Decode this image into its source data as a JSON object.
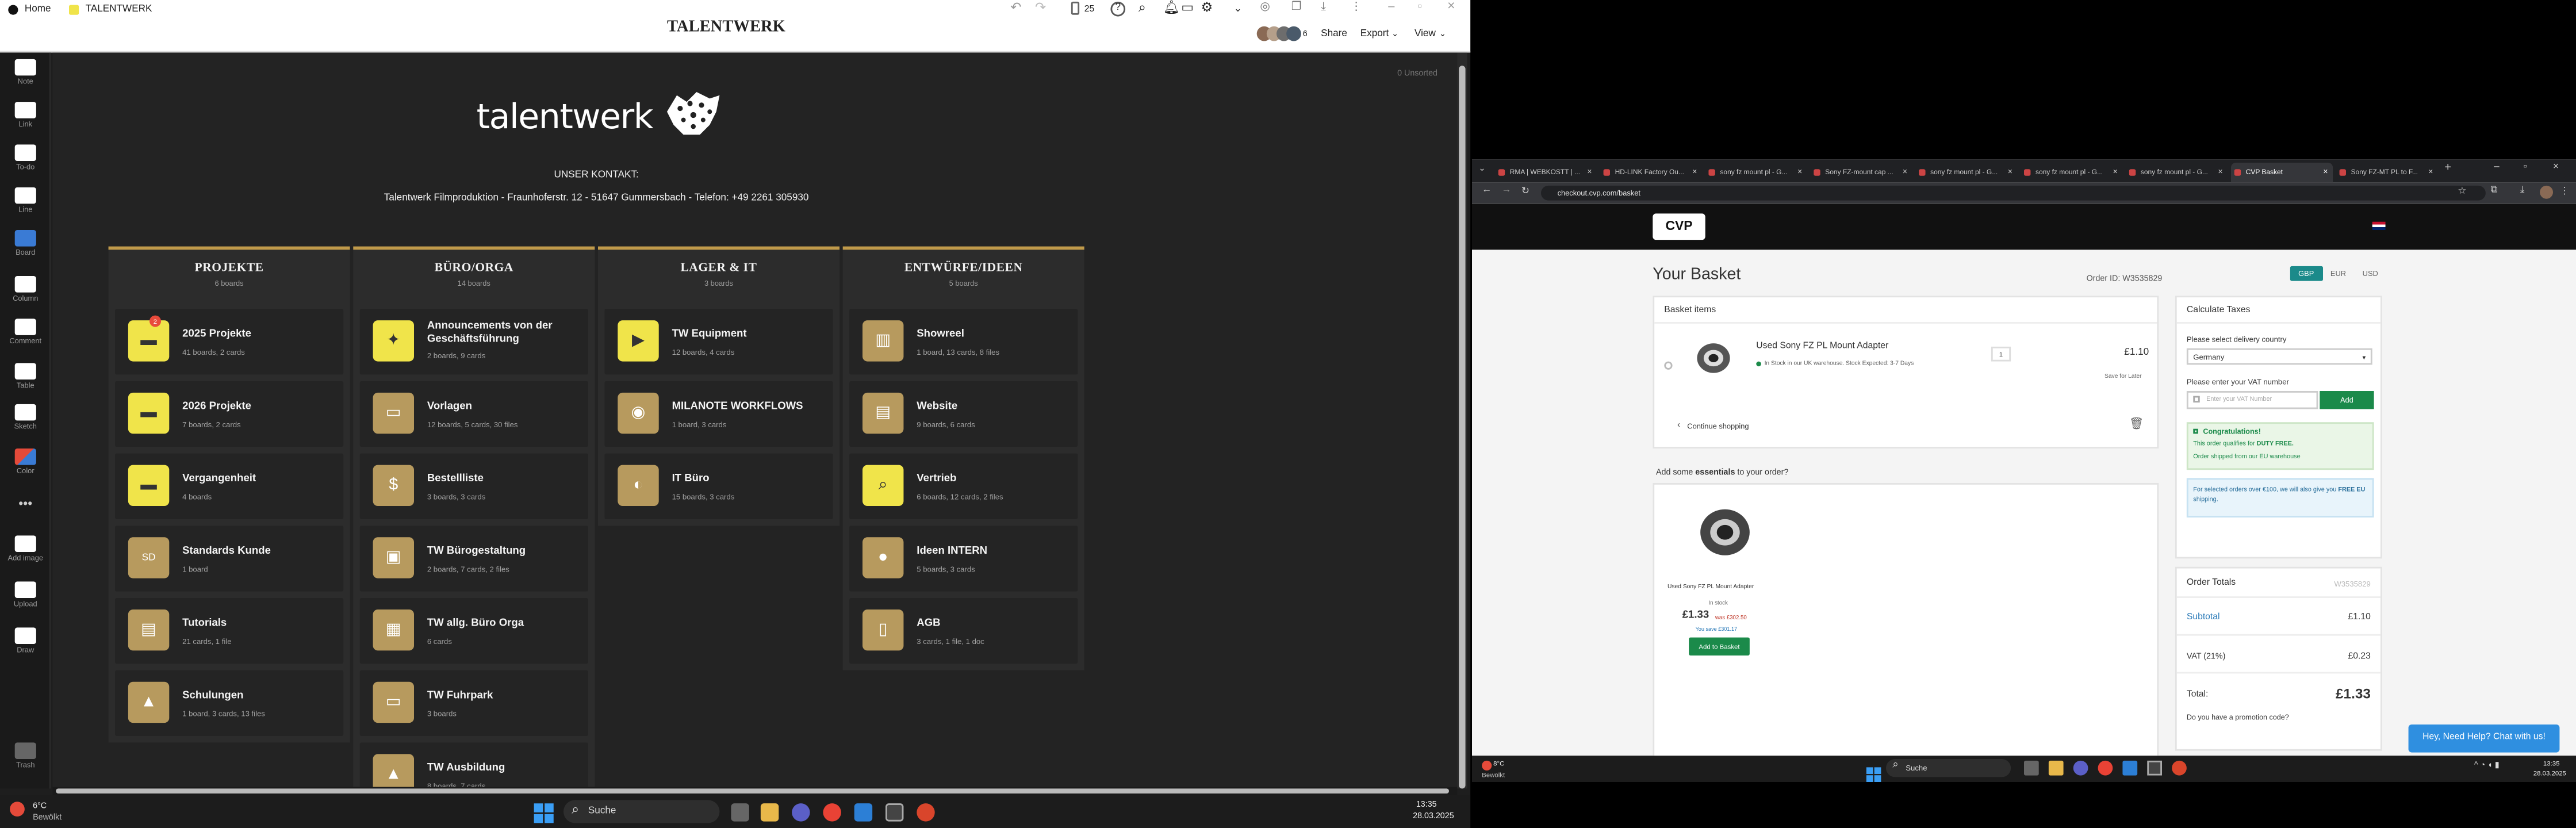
{
  "milanote": {
    "topbar": {
      "home": "Home",
      "breadcrumb": "TALENTWERK",
      "title": "TALENTWERK",
      "count": "25",
      "share": "Share",
      "export": "Export",
      "view": "View"
    },
    "sidebar": [
      {
        "label": "Note",
        "icon": "note-icon"
      },
      {
        "label": "Link",
        "icon": "link-icon"
      },
      {
        "label": "To-do",
        "icon": "todo-icon"
      },
      {
        "label": "Line",
        "icon": "line-icon"
      },
      {
        "label": "Board",
        "icon": "board-icon"
      },
      {
        "label": "Column",
        "icon": "column-icon"
      },
      {
        "label": "Comment",
        "icon": "comment-icon"
      },
      {
        "label": "Table",
        "icon": "table-icon"
      },
      {
        "label": "Sketch",
        "icon": "sketch-icon"
      },
      {
        "label": "Color",
        "icon": "color-icon"
      },
      {
        "label": "Add image",
        "icon": "image-icon"
      },
      {
        "label": "Upload",
        "icon": "upload-icon"
      },
      {
        "label": "Draw",
        "icon": "draw-icon"
      },
      {
        "label": "Trash",
        "icon": "trash-icon"
      }
    ],
    "unsorted": "0 Unsorted",
    "logo_text": "talentwerk",
    "contact_heading": "UNSER KONTAKT:",
    "contact_line": "Talentwerk Filmproduktion - Fraunhoferstr. 12 - 51647 Gummersbach - Telefon: +49 2261 305930",
    "columns": [
      {
        "title": "PROJEKTE",
        "subtitle": "6 boards",
        "cards": [
          {
            "name": "2025 Projekte",
            "sub": "41 boards, 2 cards",
            "style": "y",
            "icon": "folder-icon",
            "badge": "2"
          },
          {
            "name": "2026 Projekte",
            "sub": "7 boards, 2 cards",
            "style": "y",
            "icon": "folder-icon"
          },
          {
            "name": "Vergangenheit",
            "sub": "4 boards",
            "style": "y",
            "icon": "folder-icon"
          },
          {
            "name": "Standards Kunde",
            "sub": "1 board",
            "style": "g",
            "icon": "sd-icon"
          },
          {
            "name": "Tutorials",
            "sub": "21 cards, 1 file",
            "style": "g",
            "icon": "book-icon"
          },
          {
            "name": "Schulungen",
            "sub": "1 board, 3 cards, 13 files",
            "style": "g",
            "icon": "graduation-icon"
          }
        ]
      },
      {
        "title": "BÜRO/ORGA",
        "subtitle": "14 boards",
        "cards": [
          {
            "name": "Announcements von der Geschäftsführung",
            "sub": "2 boards, 9 cards",
            "style": "y",
            "icon": "megaphone-icon"
          },
          {
            "name": "Vorlagen",
            "sub": "12 boards, 5 cards, 30 files",
            "style": "g",
            "icon": "folder-open-icon"
          },
          {
            "name": "Bestellliste",
            "sub": "3 boards, 3 cards",
            "style": "g",
            "icon": "moneybag-icon"
          },
          {
            "name": "TW Bürogestaltung",
            "sub": "2 boards, 7 cards, 2 files",
            "style": "g",
            "icon": "briefcase-icon"
          },
          {
            "name": "TW allg. Büro Orga",
            "sub": "6 cards",
            "style": "g",
            "icon": "grid-icon"
          },
          {
            "name": "TW Fuhrpark",
            "sub": "3 boards",
            "style": "g",
            "icon": "car-icon"
          },
          {
            "name": "TW Ausbildung",
            "sub": "8 boards, 7 cards",
            "style": "g",
            "icon": "graduation-icon"
          }
        ]
      },
      {
        "title": "LAGER & IT",
        "subtitle": "3 boards",
        "cards": [
          {
            "name": "TW Equipment",
            "sub": "12 boards, 4 cards",
            "style": "y",
            "icon": "camera-icon"
          },
          {
            "name": "MILANOTE WORKFLOWS",
            "sub": "1 board, 3 cards",
            "style": "g",
            "icon": "milanote-icon"
          },
          {
            "name": "IT Büro",
            "sub": "15 boards, 3 cards",
            "style": "g",
            "icon": "toggle-icon"
          }
        ]
      },
      {
        "title": "ENTWÜRFE/IDEEN",
        "subtitle": "5 boards",
        "cards": [
          {
            "name": "Showreel",
            "sub": "1 board, 13 cards, 8 files",
            "style": "g",
            "icon": "film-icon"
          },
          {
            "name": "Website",
            "sub": "9 boards, 6 cards",
            "style": "g",
            "icon": "browser-icon"
          },
          {
            "name": "Vertrieb",
            "sub": "6 boards, 12 cards, 2 files",
            "style": "y",
            "icon": "search-money-icon"
          },
          {
            "name": "Ideen INTERN",
            "sub": "5 boards, 3 cards",
            "style": "g",
            "icon": "bulb-icon"
          },
          {
            "name": "AGB",
            "sub": "3 cards, 1 file, 1 doc",
            "style": "g",
            "icon": "document-icon"
          }
        ]
      }
    ]
  },
  "taskbar_left": {
    "weather_temp": "6°C",
    "weather_desc": "Bewölkt",
    "search": "Suche",
    "time": "13:35",
    "date": "28.03.2025"
  },
  "browser": {
    "tabs": [
      "RMA | WEBKOSTT | ...",
      "HD-LINK Factory Ou...",
      "sony fz mount pl - G...",
      "Sony FZ-mount cap ...",
      "sony fz mount pl - G...",
      "sony fz mount pl - G...",
      "sony fz mount pl - G...",
      "CVP Basket",
      "Sony FZ-MT PL to F..."
    ],
    "active_tab": 7,
    "url": "checkout.cvp.com/basket"
  },
  "cvp": {
    "logo": "CVP",
    "basket_title": "Your Basket",
    "order_id_label": "Order ID: W3535829",
    "currencies": [
      "GBP",
      "EUR",
      "USD"
    ],
    "basket_items_heading": "Basket items",
    "item_name": "Used Sony FZ PL Mount Adapter",
    "item_stock": "In Stock in our UK warehouse. Stock Expected: 3-7 Days",
    "item_qty": "1",
    "item_price": "£1.10",
    "save_later": "Save for Later",
    "continue": "Continue shopping",
    "essentials_prefix": "Add some ",
    "essentials_bold": "essentials",
    "essentials_suffix": " to your order?",
    "rec_name": "Used Sony FZ PL Mount Adapter",
    "rec_stock": "In stock",
    "rec_price": "£1.33",
    "rec_was": "was £302.50",
    "rec_save": "You save £301.17",
    "add_basket": "Add to Basket",
    "calc_taxes": "Calculate Taxes",
    "delivery_label": "Please select delivery country",
    "country": "Germany",
    "vat_label": "Please enter your VAT number",
    "vat_placeholder": "Enter your VAT Number",
    "add": "Add",
    "congrats": "Congratulations!",
    "duty_free_pre": "This order qualifies for ",
    "duty_free_bold": "DUTY FREE.",
    "shipped_from": "Order shipped from our EU warehouse",
    "free_eu_pre": "For selected orders over €100, we will also give you ",
    "free_eu_bold": "FREE EU",
    "free_eu_post": " shipping.",
    "totals_heading": "Order Totals",
    "totals_id": "W3535829",
    "subtotal_label": "Subtotal",
    "subtotal": "£1.10",
    "vat_row_label": "VAT (21%)",
    "vat_value": "£0.23",
    "total_label": "Total:",
    "total": "£1.33",
    "promo": "Do you have a promotion code?",
    "chat": "Hey, Need Help? Chat with us!"
  },
  "taskbar_right": {
    "weather_temp": "8°C",
    "weather_desc": "Bewölkt",
    "search": "Suche",
    "time": "13:35",
    "date": "28.03.2025"
  },
  "colors": {
    "accent_yellow": "#f0e44a",
    "accent_gold": "#b79a5e",
    "cvp_green": "#1b8a4a",
    "chat_blue": "#2f8fe0"
  }
}
